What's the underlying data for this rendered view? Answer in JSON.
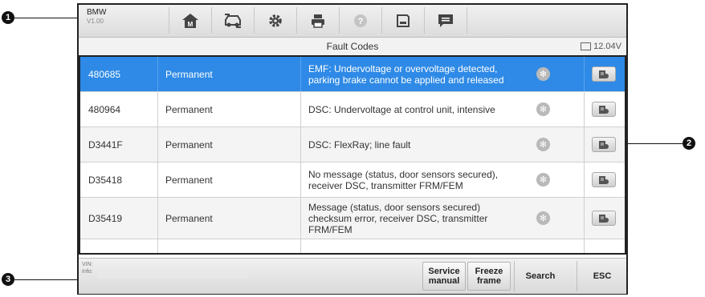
{
  "callouts": {
    "c1": "1",
    "c2": "2",
    "c3": "3"
  },
  "toolbar": {
    "make": "BMW",
    "version": "V1.00",
    "buttons": [
      {
        "icon": "home-icon"
      },
      {
        "icon": "vehicle-swap-icon"
      },
      {
        "icon": "settings-gear-icon"
      },
      {
        "icon": "print-icon"
      },
      {
        "icon": "help-icon"
      },
      {
        "icon": "save-icon"
      },
      {
        "icon": "data-logging-icon"
      }
    ]
  },
  "header": {
    "title": "Fault Codes",
    "voltage": "12.04V"
  },
  "fault_codes": [
    {
      "code": "480685",
      "status": "Permanent",
      "desc1": "EMF: Undervoltage or overvoltage detected,",
      "desc2": "parking brake cannot be applied and released",
      "desc3": "",
      "selected": true
    },
    {
      "code": "480964",
      "status": "Permanent",
      "desc1": "DSC: Undervoltage at control unit, intensive",
      "desc2": "",
      "desc3": ""
    },
    {
      "code": "D3441F",
      "status": "Permanent",
      "desc1": "DSC: FlexRay; line fault",
      "desc2": "",
      "desc3": ""
    },
    {
      "code": "D35418",
      "status": "Permanent",
      "desc1": "No message (status, door sensors secured),",
      "desc2": "receiver DSC, transmitter FRM/FEM",
      "desc3": ""
    },
    {
      "code": "D35419",
      "status": "Permanent",
      "desc1": "Message (status, door sensors secured)",
      "desc2": "checksum error, receiver DSC, transmitter",
      "desc3": "FRM/FEM"
    }
  ],
  "bottom": {
    "vin_label": "VIN:",
    "info_label": "Info:",
    "service_manual_1": "Service",
    "service_manual_2": "manual",
    "freeze_frame_1": "Freeze",
    "freeze_frame_2": "frame",
    "search": "Search",
    "esc": "ESC"
  },
  "colors": {
    "selected_row": "#2e8ae6",
    "frame": "#222222"
  }
}
